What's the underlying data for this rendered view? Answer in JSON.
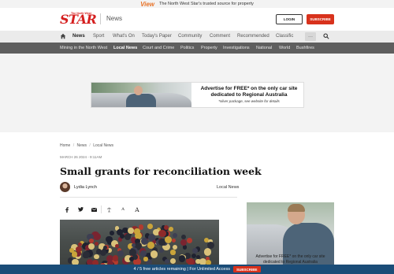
{
  "promo": {
    "brand": "View",
    "text": "The North West Star's trusted source for property"
  },
  "header": {
    "logo_small": "The North West",
    "logo_big": "STAR",
    "section": "News",
    "login_label": "LOGIN",
    "subscribe_label": "SUBSCRIBE"
  },
  "nav_primary": {
    "items": [
      "News",
      "Sport",
      "What's On",
      "Today's Paper",
      "Community",
      "Comment",
      "Recommended",
      "Classific"
    ],
    "active": "News",
    "more_label": "···"
  },
  "nav_secondary": {
    "items": [
      "Mining in the North West",
      "Local News",
      "Court and Crime",
      "Politics",
      "Property",
      "Investigations",
      "National",
      "World",
      "Bushfires"
    ],
    "active": "Local News"
  },
  "ad_banner": {
    "headline": "Advertise for FREE* on the only car site dedicated to Regional Australia",
    "subtext": "*silver package, see website for details"
  },
  "article": {
    "breadcrumb": [
      "Home",
      "News",
      "Local News"
    ],
    "breadcrumb_sep": "/",
    "timestamp": "MARCH 26 2024 - 9:11AM",
    "title": "Small grants for reconciliation week",
    "author": "Lydia Lynch",
    "category": "Local News"
  },
  "share": {
    "icons": [
      "facebook-icon",
      "twitter-icon",
      "email-icon",
      "print-icon",
      "text-size-small",
      "text-size-large"
    ],
    "font_small": "A",
    "font_large": "A"
  },
  "side_ad": {
    "text": "Advertise for FREE* on the only car site dedicated to Regional Australia"
  },
  "paywall": {
    "text": "4 / 5 free articles remaining | For Unlimited Access",
    "button": "SUBSCRIBE"
  },
  "colors": {
    "brand_red": "#d51f1f",
    "subscribe_red": "#d8321c",
    "paywall_blue": "#1b4d78",
    "subnav_grey": "#5e5e5e"
  }
}
